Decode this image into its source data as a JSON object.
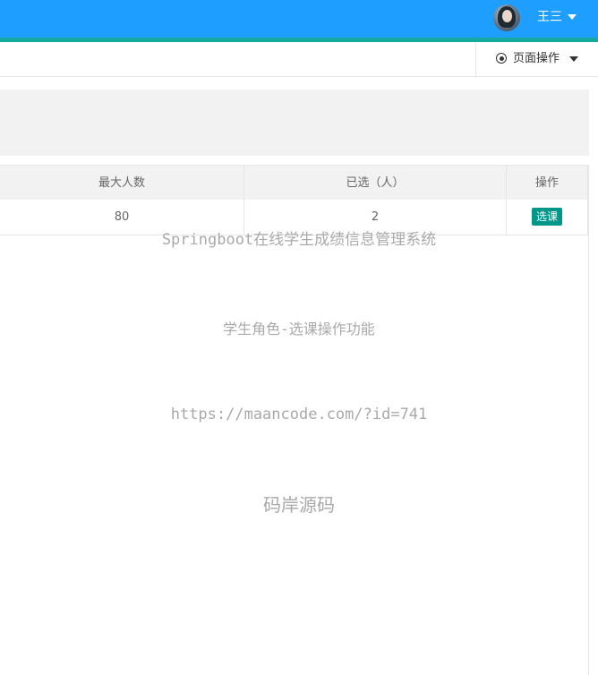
{
  "header": {
    "username": "王三",
    "colors": {
      "bar": "#1e9fff",
      "strip": "#16a9a0"
    }
  },
  "tabbar": {
    "page_ops_label": "页面操作"
  },
  "table": {
    "columns": [
      "最大人数",
      "已选（人）",
      "操作"
    ],
    "rows": [
      {
        "max_people": "80",
        "selected": "2",
        "action_label": "选课"
      }
    ],
    "action_color": "#009688"
  },
  "watermark": {
    "line1": "Springboot在线学生成绩信息管理系统",
    "line2": "学生角色-选课操作功能",
    "line3": "https://maancode.com/?id=741",
    "line4": "码岸源码"
  }
}
